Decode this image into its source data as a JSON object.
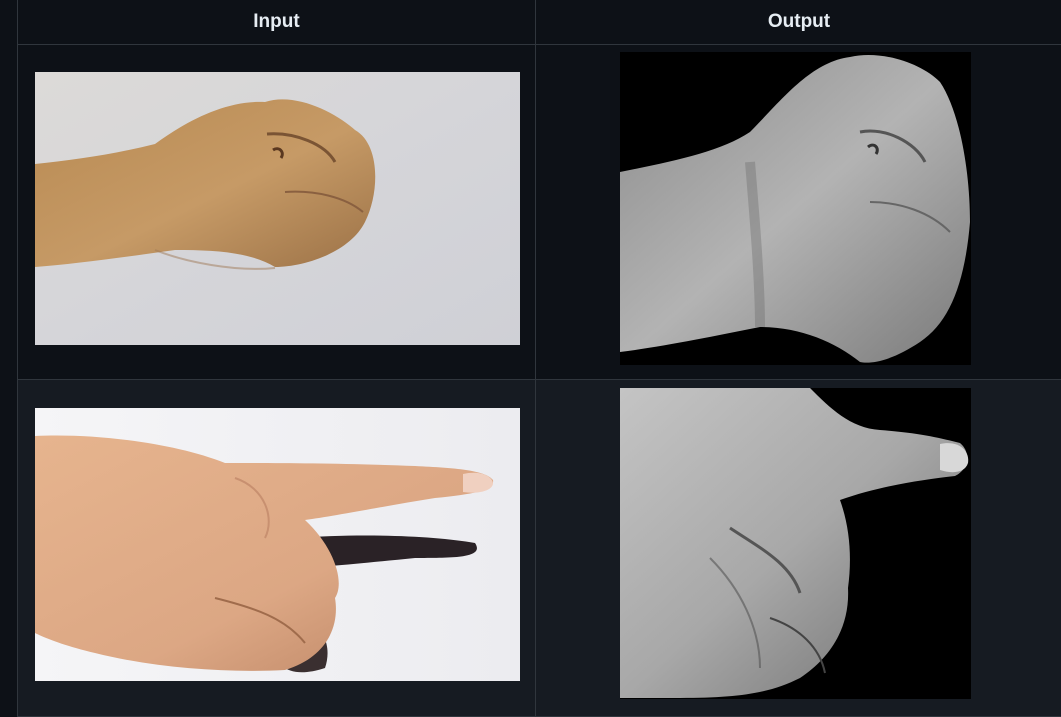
{
  "table": {
    "headers": [
      "Input",
      "Output"
    ],
    "rows": [
      {
        "input_image": "hand-fist-color-photo",
        "output_image": "hand-fist-grayscale-segmented"
      },
      {
        "input_image": "hand-pointing-color-photo",
        "output_image": "hand-pointing-grayscale-segmented"
      }
    ]
  },
  "colors": {
    "background": "#0d1117",
    "row_alt_background": "#161b22",
    "border": "#30363d",
    "header_text": "#e6edf3"
  }
}
